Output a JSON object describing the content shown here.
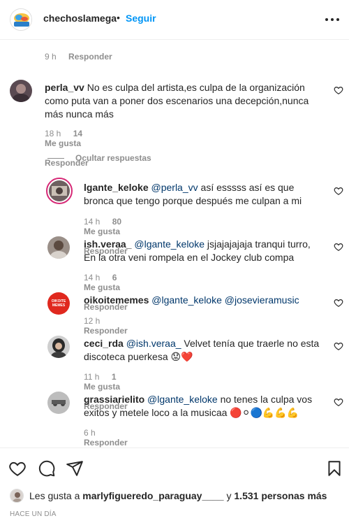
{
  "header": {
    "username": "chechoslamega",
    "separator": "•",
    "follow_label": "Seguir"
  },
  "top_meta": {
    "time": "9 h",
    "reply_label": "Responder"
  },
  "comments": [
    {
      "username": "perla_vv",
      "text": "No es culpa del artista,es culpa de la organización como puta van a poner dos escenarios una decepción,nunca más nunca más",
      "time": "18 h",
      "likes": "14 Me gusta",
      "reply_label": "Responder"
    }
  ],
  "hide_replies_label": "Ocultar respuestas",
  "replies": [
    {
      "username": "lgante_keloke",
      "mention": "@perla_vv",
      "text": "así esssss así es que bronca que tengo porque después me culpan a mi",
      "time": "14 h",
      "likes": "80 Me gusta",
      "reply_label": "Responder"
    },
    {
      "username": "ish.veraa_",
      "mention": "@lgante_keloke",
      "text": "jsjajajajaja tranqui turro, En la otra veni rompela en el Jockey club compa",
      "time": "14 h",
      "likes": "6 Me gusta",
      "reply_label": "Responder"
    },
    {
      "username": "oikoitememes",
      "mention": "@lgante_keloke",
      "mention2": "@josevieramusic",
      "text": "",
      "time": "12 h",
      "likes": "",
      "reply_label": "Responder",
      "avatar_text": "OIKOITE MEMES"
    },
    {
      "username": "ceci_rda",
      "mention": "@ish.veraa_",
      "text": "Velvet tenía que traerle no esta discoteca puerkesa",
      "emoji": "😟❤️",
      "time": "11 h",
      "likes": "1 Me gusta",
      "reply_label": "Responder"
    },
    {
      "username": "grassiarielito",
      "mention": "@lgante_keloke",
      "text": "no tenes la culpa vos exitos y metele loco a la musicaa",
      "emoji": "🔴⚪🔵💪💪💪",
      "time": "6 h",
      "likes": "",
      "reply_label": "Responder"
    }
  ],
  "likes_row": {
    "prefix": "Les gusta a",
    "user": "marlyfiguered​o_paraguay____",
    "middle": "y",
    "count": "1.531 personas más"
  },
  "timeago": "HACE UN DÍA",
  "colors": {
    "accent": "#0095f6",
    "mention": "#00376b",
    "muted": "#8e8e8e",
    "text": "#262626"
  }
}
